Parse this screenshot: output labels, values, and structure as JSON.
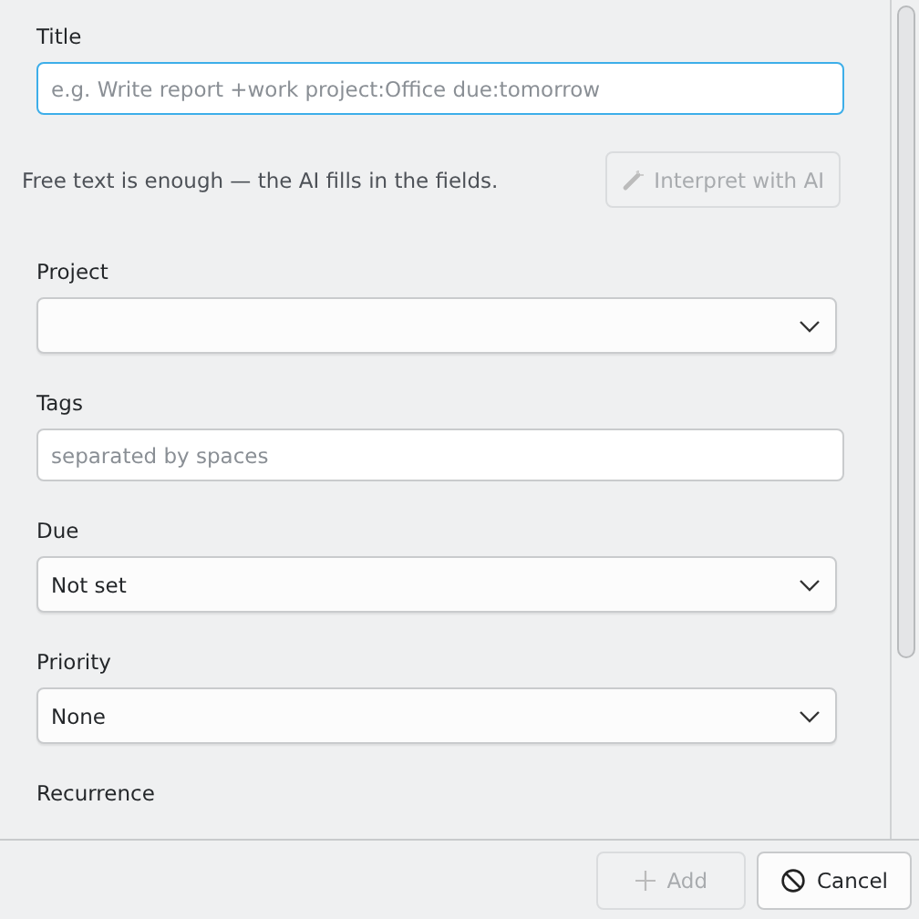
{
  "form": {
    "fields": [
      {
        "kind": "input",
        "label": "Title",
        "placeholder": "e.g. Write report +work project:Office due:tomorrow",
        "focused": true
      },
      {
        "kind": "hint",
        "text": "Free text is enough — the AI fills in the fields.",
        "button": {
          "label": "Interpret with AI",
          "disabled": true
        }
      },
      {
        "kind": "select",
        "label": "Project"
      },
      {
        "kind": "input",
        "label": "Tags",
        "placeholder": "separated by spaces",
        "focused": false
      },
      {
        "kind": "select",
        "label": "Due",
        "value": "Not set"
      },
      {
        "kind": "select",
        "label": "Priority",
        "value": "None"
      },
      {
        "kind": "label",
        "label": "Recurrence"
      }
    ]
  },
  "buttons": [
    {
      "kind": "add",
      "label": "Add",
      "disabled": true
    },
    {
      "kind": "cancel",
      "label": "Cancel",
      "disabled": false
    }
  ]
}
